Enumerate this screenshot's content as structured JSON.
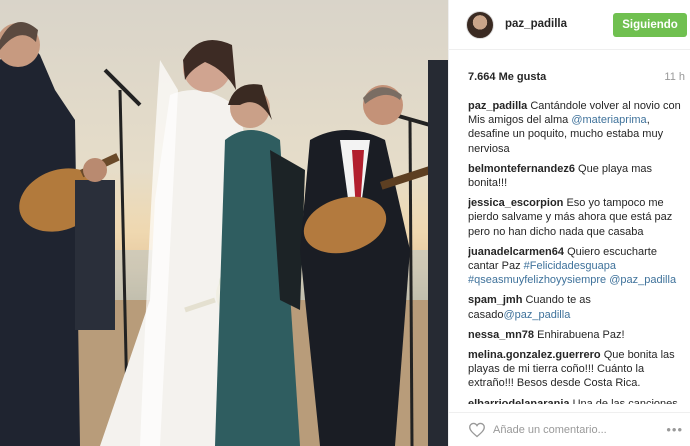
{
  "post": {
    "photo_alt": "",
    "username": "paz_padilla",
    "follow_label": "Siguiendo",
    "likes": "7.664 Me gusta",
    "time_ago": "11 h",
    "comment_placeholder": "Añade un comentario...",
    "more_label": "•••"
  },
  "comments": [
    {
      "author": "paz_padilla",
      "parts": [
        {
          "t": "Cantándole volver al novio con Mis amigos del alma "
        },
        {
          "t": "@materiaprima",
          "tag": true
        },
        {
          "t": ", desafine un poquito, mucho estaba muy nerviosa"
        }
      ]
    },
    {
      "author": "belmontefernandez6",
      "parts": [
        {
          "t": "Que playa mas bonita!!!"
        }
      ]
    },
    {
      "author": "jessica_escorpion",
      "parts": [
        {
          "t": "Eso yo tampoco me pierdo salvame y más ahora que está paz pero no han dicho nada que casaba"
        }
      ]
    },
    {
      "author": "juanadelcarmen64",
      "parts": [
        {
          "t": "Quiero escucharte cantar Paz "
        },
        {
          "t": "#Felicidadesguapa",
          "tag": true
        },
        {
          "t": " "
        },
        {
          "t": "#qseasmuyfelizhoyysiempre",
          "tag": true
        },
        {
          "t": " "
        },
        {
          "t": "@paz_padilla",
          "tag": true
        }
      ]
    },
    {
      "author": "spam_jmh",
      "parts": [
        {
          "t": "Cuando te as casado"
        },
        {
          "t": "@paz_padilla",
          "tag": true
        }
      ]
    },
    {
      "author": "nessa_mn78",
      "parts": [
        {
          "t": "Enhirabuena Paz!"
        }
      ]
    },
    {
      "author": "melina.gonzalez.guerrero",
      "parts": [
        {
          "t": "Que bonita las playas de mi tierra coño!!! Cuánto la extraño!!! Besos desde Costa Rica."
        }
      ]
    },
    {
      "author": "elbarriodelanaranja",
      "parts": [
        {
          "t": "Una de las canciones de Materia Prima"
        }
      ]
    }
  ],
  "colors": {
    "follow_button": "#70c050",
    "link": "#3f729b",
    "text": "#262626",
    "muted": "#999999"
  }
}
